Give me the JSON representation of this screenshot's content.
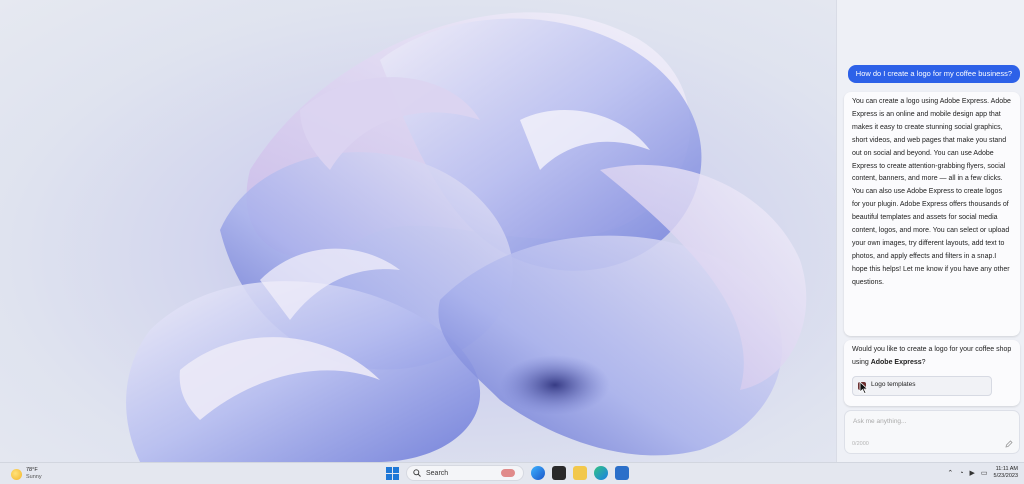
{
  "copilot": {
    "user_message": "How do I create a logo for my coffee business?",
    "bot_paragraph_1": "You can create a logo using Adobe Express. Adobe Express is an online and mobile design app that makes it easy to create stunning social graphics, short videos, and web pages that make you stand out on social and beyond. You can use Adobe Express to create attention-grabbing flyers, social content, banners, and more — all in a few clicks.",
    "bot_paragraph_2": "You can also use Adobe Express to create logos for your plugin. Adobe Express offers thousands of beautiful templates and assets for social media content, logos, and more. You can select or upload your own images, try different layouts, add text to photos, and apply effects and filters in a snap.I hope this helps! Let me know if you have any other questions.",
    "followup_prefix": "Would you like to create a logo for your coffee shop using ",
    "followup_brand": "Adobe Express",
    "followup_suffix": "?",
    "suggestion_label": "Logo templates",
    "input_placeholder": "Ask me anything...",
    "input_counter": "0/2000"
  },
  "taskbar": {
    "weather_temp": "78°F",
    "weather_condition": "Sunny",
    "search_label": "Search",
    "time": "11:11 AM",
    "date": "5/23/2023"
  },
  "colors": {
    "user_bubble": "#2d61e8",
    "panel_bg": "#eef0f6",
    "windows_blue": "#1e78d7"
  }
}
